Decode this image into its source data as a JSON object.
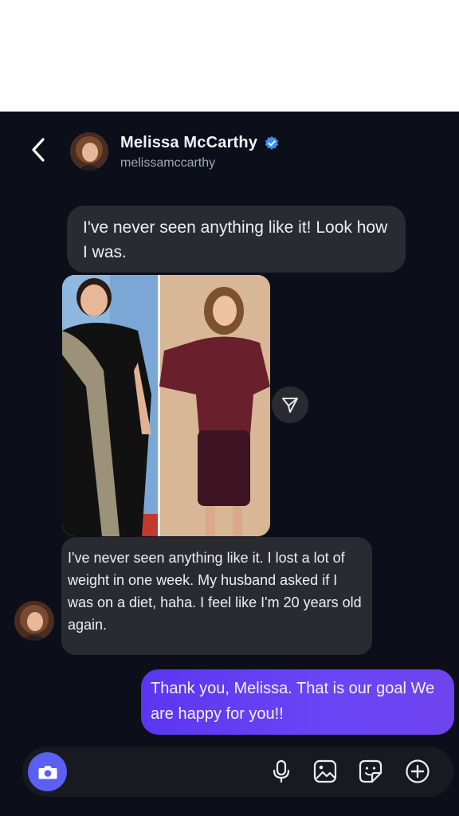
{
  "header": {
    "name": "Melissa McCarthy",
    "handle": "melissamccarthy"
  },
  "messages": {
    "incoming_1": "I've never seen anything like it! Look how I was.",
    "incoming_2": "I've never seen anything like it. I lost a lot of weight in one week. My husband asked if I was on a diet, haha. I feel like I'm 20 years old again.",
    "outgoing_1": "Thank you, Melissa. That is our goal We are happy for you!!"
  },
  "composer": {
    "placeholder": ""
  },
  "colors": {
    "background": "#0c0f1a",
    "incoming_bubble": "#2a2b31",
    "outgoing_bubble": "#6a45f5",
    "verified": "#3a8ef6",
    "camera_button": "#5b5ff2"
  },
  "icons": {
    "back": "chevron-left-icon",
    "verified": "verified-badge-icon",
    "share": "send-icon",
    "camera": "camera-icon",
    "mic": "microphone-icon",
    "gallery": "image-icon",
    "sticker": "sticker-icon",
    "plus": "plus-circle-icon"
  }
}
